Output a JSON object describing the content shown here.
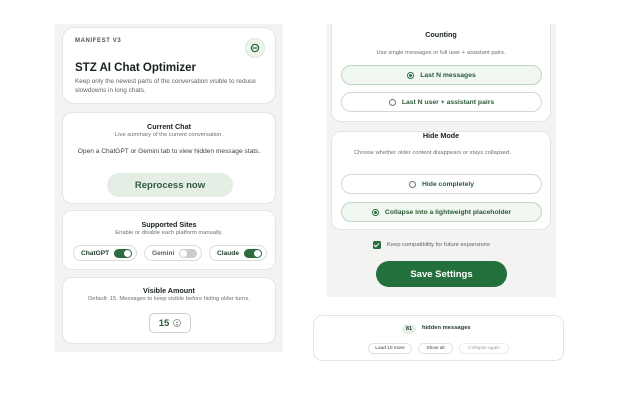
{
  "header": {
    "eyebrow": "MANIFEST V3",
    "title": "STZ AI Chat Optimizer",
    "subtitle": "Keep only the newest parts of the conversation visible to reduce slowdowns in long chats."
  },
  "current_chat": {
    "title": "Current Chat",
    "subtitle": "Live summary of the current conversation.",
    "message": "Open a ChatGPT or Gemini tab to view hidden message stats.",
    "button_label": "Reprocess now"
  },
  "supported_sites": {
    "title": "Supported Sites",
    "subtitle": "Enable or disable each platform manually.",
    "sites": [
      {
        "label": "ChatGPT",
        "enabled": true
      },
      {
        "label": "Gemini",
        "enabled": false
      },
      {
        "label": "Claude",
        "enabled": true
      }
    ]
  },
  "visible_amount": {
    "title": "Visible Amount",
    "subtitle": "Default: 15. Messages to keep visible before hiding older turns.",
    "value": "15"
  },
  "counting": {
    "title": "Counting",
    "subtitle": "Use single messages or full user + assistant pairs.",
    "options": [
      {
        "label": "Last N messages",
        "selected": true
      },
      {
        "label": "Last N user + assistant pairs",
        "selected": false
      }
    ]
  },
  "hide_mode": {
    "title": "Hide Mode",
    "subtitle": "Choose whether older content disappears or stays collapsed.",
    "options": [
      {
        "label": "Hide completely",
        "selected": false
      },
      {
        "label": "Collapse into a lightweight placeholder",
        "selected": true
      }
    ]
  },
  "compat": {
    "label": "Keep compatibility for future expansions",
    "checked": true
  },
  "save_label": "Save Settings",
  "placeholder_preview": {
    "count": "81",
    "label": "hidden messages",
    "buttons": [
      "Load 10 more",
      "Show all",
      "Collapse again"
    ]
  },
  "colors": {
    "accent": "#24703c",
    "soft_accent": "#e5eee5",
    "panel_bg": "#f3f4f2"
  }
}
